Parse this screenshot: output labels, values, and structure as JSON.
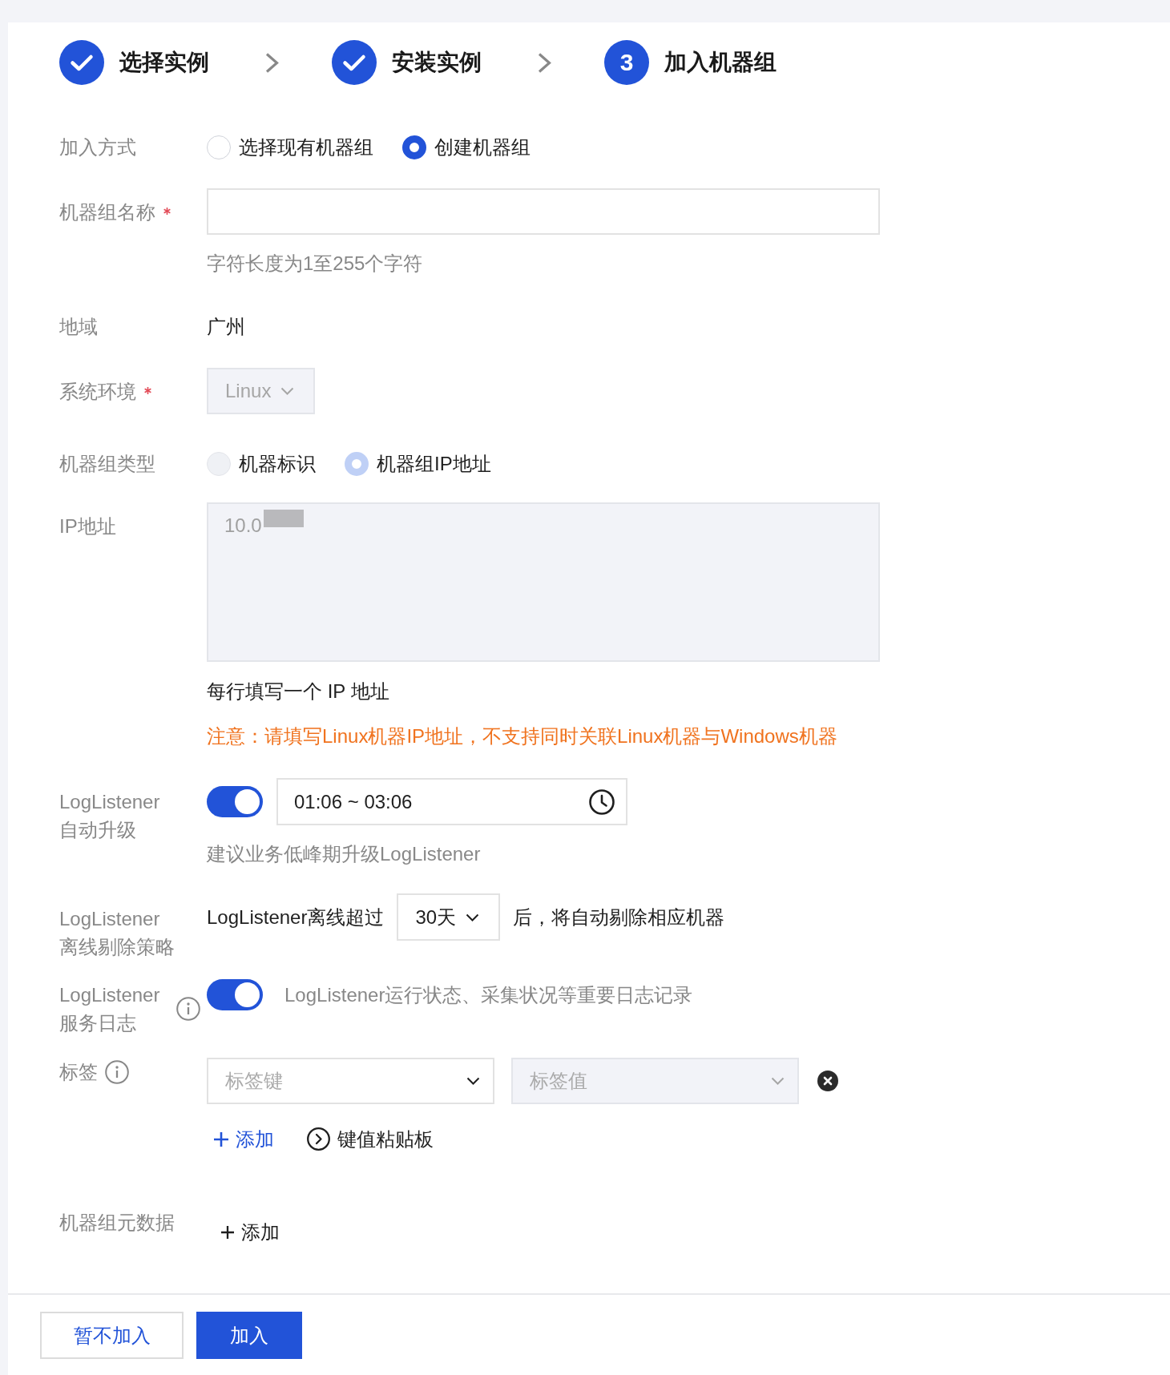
{
  "steps": [
    {
      "label": "选择实例",
      "done": true
    },
    {
      "label": "安装实例",
      "done": true
    },
    {
      "label": "加入机器组",
      "done": false,
      "number": "3"
    }
  ],
  "join_mode": {
    "label": "加入方式",
    "options": [
      {
        "label": "选择现有机器组",
        "selected": false
      },
      {
        "label": "创建机器组",
        "selected": true
      }
    ]
  },
  "group_name": {
    "label": "机器组名称",
    "required": true,
    "help": "字符长度为1至255个字符"
  },
  "region": {
    "label": "地域",
    "value": "广州"
  },
  "os": {
    "label": "系统环境",
    "required": true,
    "value": "Linux",
    "disabled": true
  },
  "group_type": {
    "label": "机器组类型",
    "options": [
      {
        "label": "机器标识",
        "selected": false,
        "disabled": true
      },
      {
        "label": "机器组IP地址",
        "selected": true,
        "disabled": true
      }
    ]
  },
  "ip": {
    "label": "IP地址",
    "value": "10.0",
    "disabled": true,
    "redacted": true,
    "help": "每行填写一个 IP 地址",
    "warning": "注意：请填写Linux机器IP地址，不支持同时关联Linux机器与Windows机器"
  },
  "auto_upgrade": {
    "label": "LogListener自动升级",
    "on": true,
    "time_range": "01:06 ~ 03:06",
    "help": "建议业务低峰期升级LogListener"
  },
  "offline_removal": {
    "label": "LogListener离线剔除策略",
    "prefix": "LogListener离线超过",
    "value": "30天",
    "suffix": "后，将自动剔除相应机器"
  },
  "service_log": {
    "label": "LogListener服务日志",
    "on": true,
    "description": "LogListener运行状态、采集状况等重要日志记录"
  },
  "tags": {
    "label": "标签",
    "rows": [
      {
        "key": {
          "placeholder": "标签键",
          "disabled": false
        },
        "value": {
          "placeholder": "标签值",
          "disabled": true
        }
      }
    ],
    "add": "添加",
    "paste": "键值粘贴板"
  },
  "metadata": {
    "label": "机器组元数据",
    "add": "添加"
  },
  "footer": {
    "buttons": [
      {
        "label": "暂不加入",
        "kind": "secondary"
      },
      {
        "label": "加入",
        "kind": "primary"
      }
    ]
  }
}
